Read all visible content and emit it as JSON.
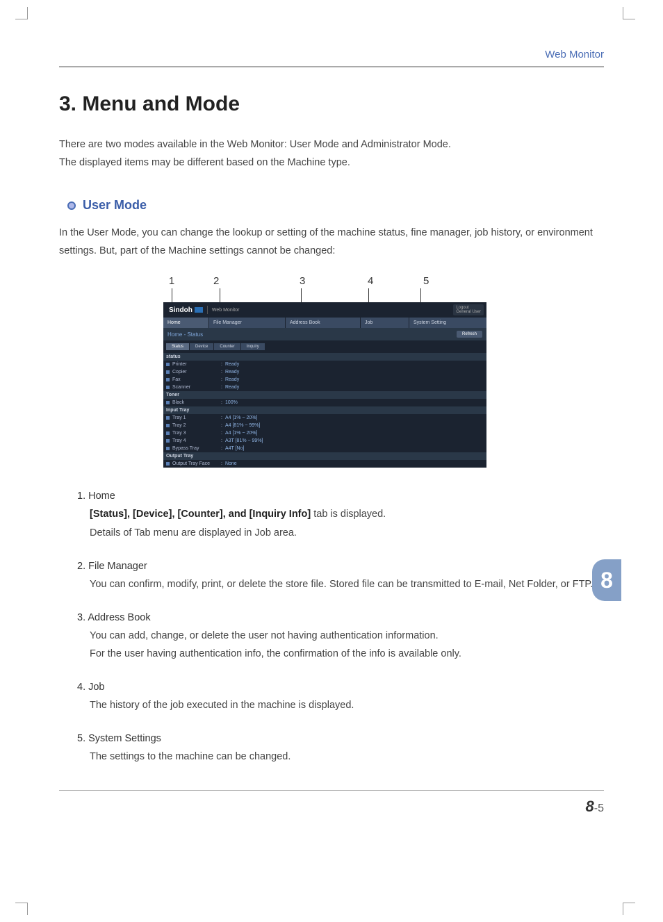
{
  "header": {
    "label": "Web Monitor"
  },
  "title": "3. Menu and Mode",
  "intro_line1": "There are two modes available in the Web Monitor: User Mode and Administrator Mode.",
  "intro_line2": "The displayed items may be different based on the Machine type.",
  "subhead": "User Mode",
  "subdesc": "In the User Mode, you can change the lookup or setting of the machine status, fine manager, job history, or environment settings. But, part of the Machine settings cannot be changed:",
  "callouts": {
    "c1": "1",
    "c2": "2",
    "c3": "3",
    "c4": "4",
    "c5": "5"
  },
  "shot": {
    "brand": "Sindoh",
    "brand_sub": "Web Monitor",
    "logout": "Logout",
    "user_role": "General User",
    "tabs": {
      "home": "Home",
      "file_manager": "File Manager",
      "address_book": "Address Book",
      "job": "Job",
      "system_setting": "System Setting"
    },
    "bread": "Home - Status",
    "refresh": "Refresh",
    "subtabs": {
      "status": "Status",
      "device": "Device",
      "counter": "Counter",
      "inquiry": "Inquiry"
    },
    "sections": {
      "status": {
        "head": "status",
        "rows": [
          {
            "lbl": "Printer",
            "val": "Ready"
          },
          {
            "lbl": "Copier",
            "val": "Ready"
          },
          {
            "lbl": "Fax",
            "val": "Ready"
          },
          {
            "lbl": "Scanner",
            "val": "Ready"
          }
        ]
      },
      "toner": {
        "head": "Toner",
        "rows": [
          {
            "lbl": "Black",
            "val": "100%"
          }
        ]
      },
      "input_tray": {
        "head": "Input Tray",
        "rows": [
          {
            "lbl": "Tray 1",
            "val": "A4 [1% ~ 20%]"
          },
          {
            "lbl": "Tray 2",
            "val": "A4 [81% ~ 99%]"
          },
          {
            "lbl": "Tray 3",
            "val": "A4 [1% ~ 20%]"
          },
          {
            "lbl": "Tray 4",
            "val": "A3T [81% ~ 99%]"
          },
          {
            "lbl": "Bypass Tray",
            "val": "A4T [No]"
          }
        ]
      },
      "output_tray": {
        "head": "Output Tray",
        "rows": [
          {
            "lbl": "Output Tray Face",
            "val": "None"
          }
        ]
      }
    }
  },
  "items": {
    "i1_title": "1. Home",
    "i1_bold": "[Status], [Device], [Counter], and [Inquiry Info]",
    "i1_rest": " tab is displayed.",
    "i1_line2": "Details of Tab menu are displayed in Job area.",
    "i2_title": "2. File Manager",
    "i2_body": "You can confirm, modify, print, or delete the store file. Stored file can be transmitted to E-mail, Net Folder, or FTP.",
    "i3_title": "3. Address Book",
    "i3_l1": "You can add, change, or delete the user not having authentication information.",
    "i3_l2": "For the user having authentication info, the confirmation of the info is available only.",
    "i4_title": "4. Job",
    "i4_body": "The history of the job executed in the machine is displayed.",
    "i5_title": "5. System Settings",
    "i5_body": "The settings to the machine can be changed."
  },
  "side_tab": "8",
  "page_num_big": "8",
  "page_num_rest": "-5"
}
